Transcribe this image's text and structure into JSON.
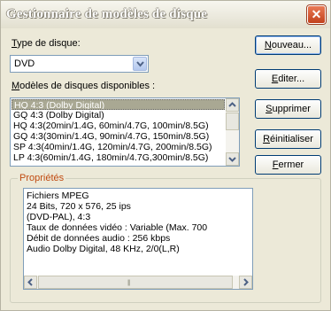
{
  "window": {
    "title": "Gestionnaire de modèles de disque",
    "close_glyph": "✕"
  },
  "disc_type": {
    "label_u": "T",
    "label_rest": "ype de disque:",
    "selected": "DVD"
  },
  "models": {
    "label_u": "M",
    "label_rest": "odèles de disques disponibles :",
    "items": [
      "HQ 4:3 (Dolby Digital)",
      "GQ 4:3 (Dolby Digital)",
      "HQ 4:3(20min/1.4G, 60min/4.7G, 100min/8.5G)",
      "GQ 4:3(30min/1.4G, 90min/4.7G, 150min/8.5G)",
      "SP 4:3(40min/1.4G, 120min/4.7G, 200min/8.5G)",
      "LP 4:3(60min/1.4G, 180min/4.7G,300min/8.5G)"
    ],
    "selected_index": 0
  },
  "buttons": {
    "new_u": "N",
    "new_rest": "ouveau...",
    "edit_u": "E",
    "edit_rest": "diter...",
    "delete_u": "S",
    "delete_rest": "upprimer",
    "reset_u": "R",
    "reset_rest": "éinitialiser",
    "close_u": "F",
    "close_rest": "ermer"
  },
  "properties": {
    "title": "Propriétés",
    "lines": [
      "Fichiers MPEG",
      "24 Bits, 720 x 576, 25 ips",
      "(DVD-PAL),  4:3",
      "Taux de données vidéo : Variable  (Max.  700",
      "Débit de données audio : 256 kbps",
      "Audio Dolby Digital, 48 KHz, 2/0(L,R)"
    ]
  }
}
